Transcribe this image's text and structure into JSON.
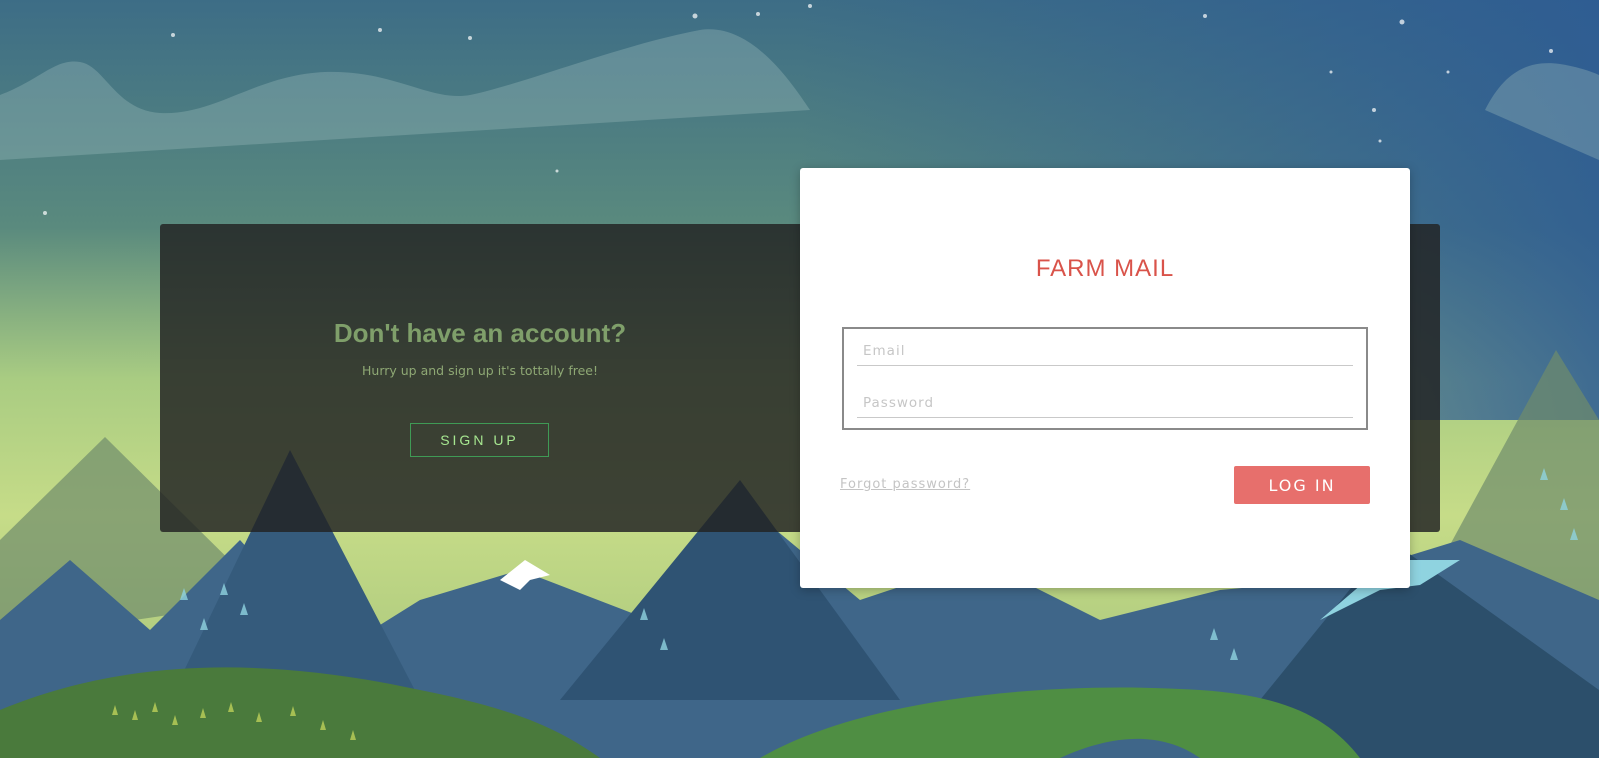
{
  "signup": {
    "title": "Don't have an account?",
    "subtitle": "Hurry up and sign up it's tottally free!",
    "button_label": "SIGN UP"
  },
  "login": {
    "brand": "FARM MAIL",
    "email_placeholder": "Email",
    "password_placeholder": "Password",
    "forgot_label": "Forgot password?",
    "button_label": "LOG IN"
  },
  "colors": {
    "brand": "#d9534a",
    "login_button": "#e76f6c",
    "signup_accent": "#3f9a55",
    "signup_title": "#7f9f6a"
  }
}
